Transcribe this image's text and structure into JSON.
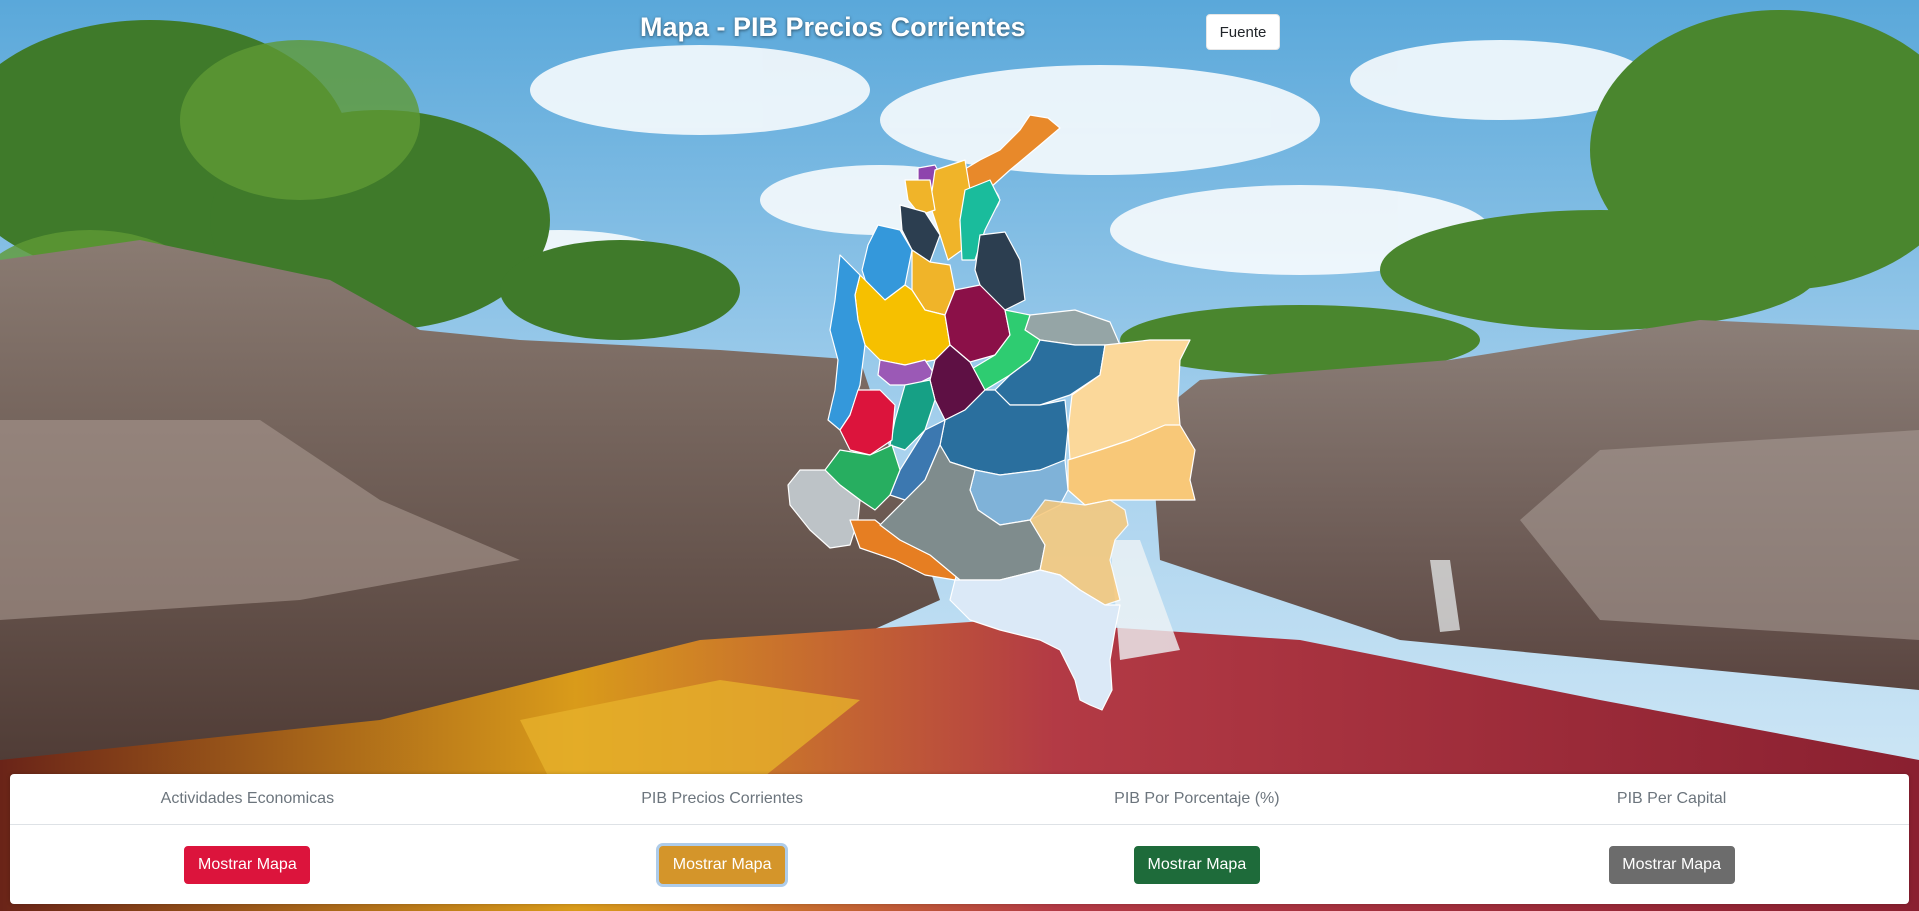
{
  "header": {
    "title": "Mapa - PIB Precios Corrientes",
    "source_button": "Fuente"
  },
  "map": {
    "shown_metric": "PIB Precios Corrientes",
    "region_colors": [
      "#e8892a",
      "#8e44ad",
      "#f0b429",
      "#1abc9c",
      "#2c3e50",
      "#3498db",
      "#f6c000",
      "#8b1048",
      "#2ecc71",
      "#95a5a6",
      "#2a6f9e",
      "#fbd89a",
      "#9b59b6",
      "#dc143c",
      "#16a085",
      "#5e1044",
      "#3c78b0",
      "#2c8ed6",
      "#7fb2d8",
      "#27ae60",
      "#bdc3c7",
      "#e67e22",
      "#7f8c8d",
      "#f8c878",
      "#dbe9f7",
      "#4a96cf"
    ]
  },
  "panel": {
    "columns": [
      {
        "label": "Actividades Economicas",
        "button": "Mostrar Mapa",
        "color": "#dc143c",
        "active": false
      },
      {
        "label": "PIB Precios Corrientes",
        "button": "Mostrar Mapa",
        "color": "#d4952a",
        "active": true
      },
      {
        "label": "PIB Por Porcentaje (%)",
        "button": "Mostrar Mapa",
        "color": "#1e6b3a",
        "active": false
      },
      {
        "label": "PIB Per Capital",
        "button": "Mostrar Mapa",
        "color": "#6c6c6c",
        "active": false
      }
    ]
  }
}
